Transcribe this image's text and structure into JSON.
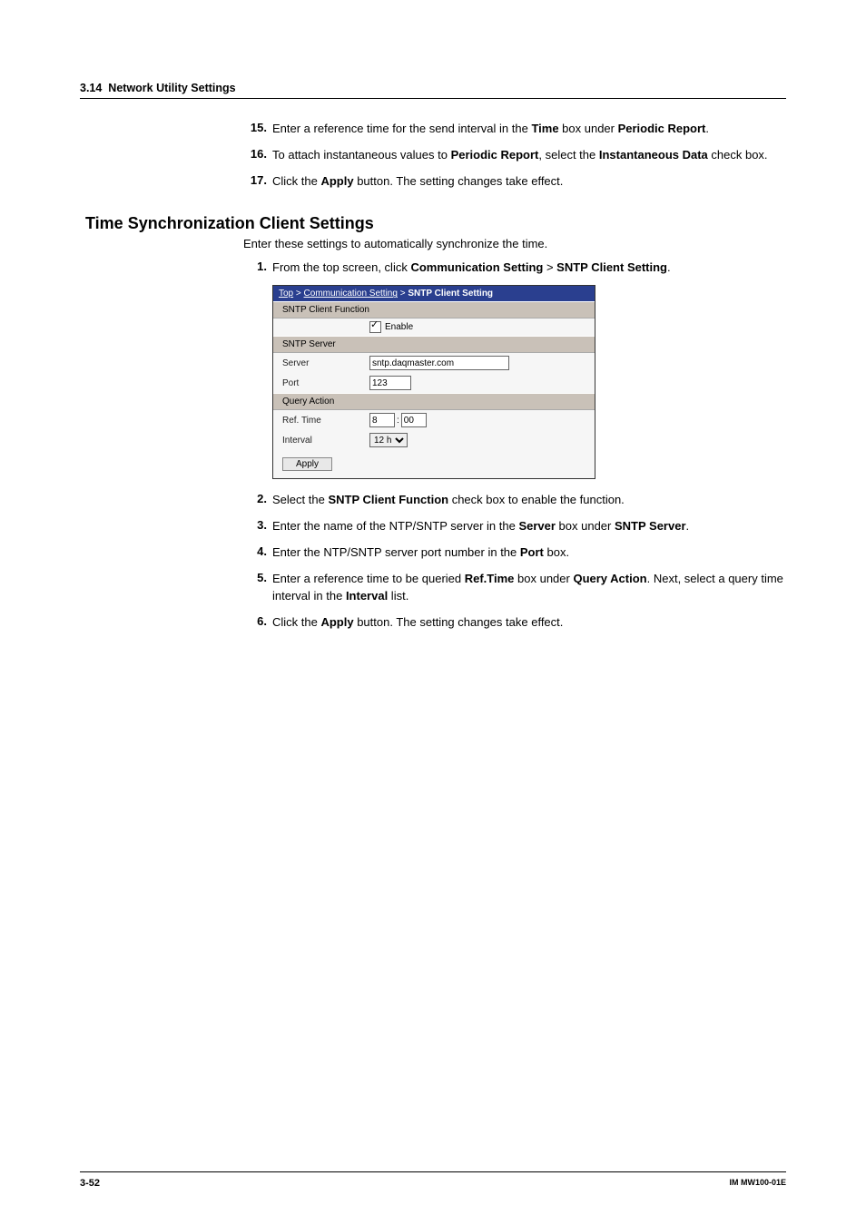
{
  "header": {
    "section_number": "3.14",
    "section_title": "Network Utility Settings"
  },
  "steps_top": [
    {
      "num": "15.",
      "parts": [
        "Enter a reference time for the send interval in the ",
        "Time",
        " box under ",
        "Periodic Report",
        "."
      ]
    },
    {
      "num": "16.",
      "parts": [
        "To attach instantaneous values to ",
        "Periodic Report",
        ", select the ",
        "Instantaneous Data",
        " check box."
      ]
    },
    {
      "num": "17.",
      "parts": [
        "Click the ",
        "Apply",
        " button. The setting changes take effect."
      ]
    }
  ],
  "subsection": {
    "title": "Time Synchronization Client Settings",
    "intro": "Enter these settings to automatically synchronize the time."
  },
  "steps_bottom": [
    {
      "num": "1.",
      "parts": [
        "From the top screen, click ",
        "Communication Setting",
        " > ",
        "SNTP Client Setting",
        "."
      ]
    },
    {
      "num": "2.",
      "parts": [
        "Select the ",
        "SNTP Client Function",
        " check box to enable the function."
      ]
    },
    {
      "num": "3.",
      "parts": [
        "Enter the name of the NTP/SNTP server in the ",
        "Server",
        " box under ",
        "SNTP Server",
        "."
      ]
    },
    {
      "num": "4.",
      "parts": [
        "Enter the NTP/SNTP server port number in the ",
        "Port",
        " box."
      ]
    },
    {
      "num": "5.",
      "parts": [
        "Enter a reference time to be queried ",
        "Ref.Time",
        " box under ",
        "Query Action",
        ". Next, select a query time interval in the ",
        "Interval",
        " list."
      ]
    },
    {
      "num": "6.",
      "parts": [
        "Click the ",
        "Apply",
        " button. The setting changes take effect."
      ]
    }
  ],
  "screenshot": {
    "breadcrumb": {
      "top": "Top",
      "mid": "Communication Setting",
      "leaf": "SNTP Client Setting",
      "sep": " > "
    },
    "group1": {
      "header": "SNTP Client Function",
      "checkbox_label": "Enable",
      "checked": true
    },
    "group2": {
      "header": "SNTP Server",
      "server_label": "Server",
      "server_value": "sntp.daqmaster.com",
      "port_label": "Port",
      "port_value": "123"
    },
    "group3": {
      "header": "Query Action",
      "reftime_label": "Ref. Time",
      "ref_h": "8",
      "ref_sep": ":",
      "ref_m": "00",
      "interval_label": "Interval",
      "interval_value": "12 h"
    },
    "apply": "Apply"
  },
  "footer": {
    "page": "3-52",
    "doc": "IM MW100-01E"
  }
}
